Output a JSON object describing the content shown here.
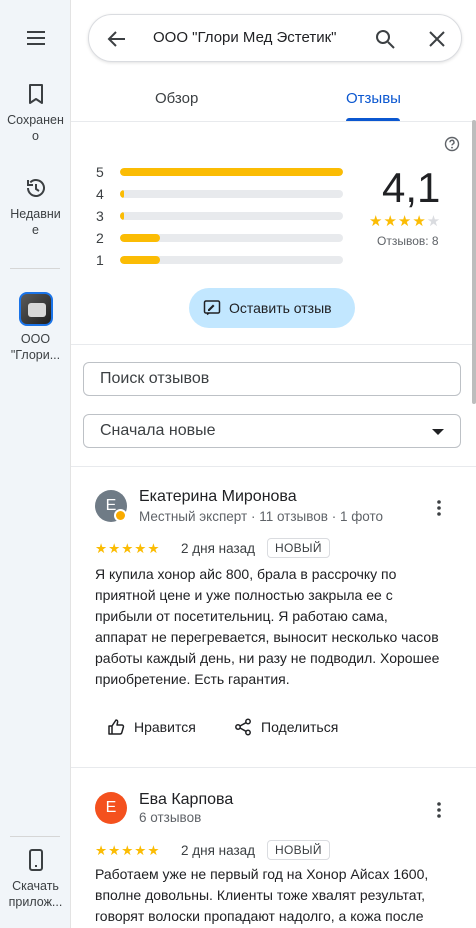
{
  "rail": {
    "menu_icon": "menu-icon",
    "saved_label": "Сохранено",
    "recent_label": "Недавние",
    "place_label": "ООО \"Глори...",
    "download_label": "Скачать прилож..."
  },
  "search": {
    "value": "ООО \"Глори Мед Эстетик\"",
    "back_icon": "arrow-back-icon",
    "search_icon": "search-icon",
    "close_icon": "close-icon"
  },
  "tabs": [
    {
      "label": "Обзор",
      "active": false
    },
    {
      "label": "Отзывы",
      "active": true
    }
  ],
  "summary": {
    "histogram": [
      {
        "stars": "5",
        "fraction": 1.0
      },
      {
        "stars": "4",
        "fraction": 0.02
      },
      {
        "stars": "3",
        "fraction": 0.01
      },
      {
        "stars": "2",
        "fraction": 0.18
      },
      {
        "stars": "1",
        "fraction": 0.18
      }
    ],
    "rating": "4,1",
    "stars": "★★★★",
    "empty_star": "★",
    "count": "Отзывов: 8",
    "write_review": "Оставить отзыв"
  },
  "search_reviews_placeholder": "Поиск отзывов",
  "sort": {
    "selected": "Сначала новые"
  },
  "reviews": [
    {
      "avatar_letter": "E",
      "avatar_color": "#6f7b86",
      "name": "Екатерина Миронова",
      "meta": "Местный эксперт · 11 отзывов · 1 фото",
      "stars": "★★★★★",
      "date": "2 дня назад",
      "badge": "НОВЫЙ",
      "text": "Я купила хонор айс 800, брала в рассрочку по приятной цене и уже полностью закрыла ее с прибыли от посетительниц. Я работаю сама, аппарат не перегревается, выносит несколько часов работы каждый день, ни разу не подводил. Хорошее приобретение. Есть гарантия.",
      "like": "Нравится",
      "share": "Поделиться"
    },
    {
      "avatar_letter": "E",
      "avatar_color": "#f4511e",
      "name": "Ева Карпова",
      "meta": "6 отзывов",
      "stars": "★★★★★",
      "date": "2 дня назад",
      "badge": "НОВЫЙ",
      "text": "Работаем уже не первый год на Хонор Айсах 1600, вполне довольны. Клиенты тоже хвалят результат, говорят волоски пропадают надолго, а кожа после"
    }
  ]
}
